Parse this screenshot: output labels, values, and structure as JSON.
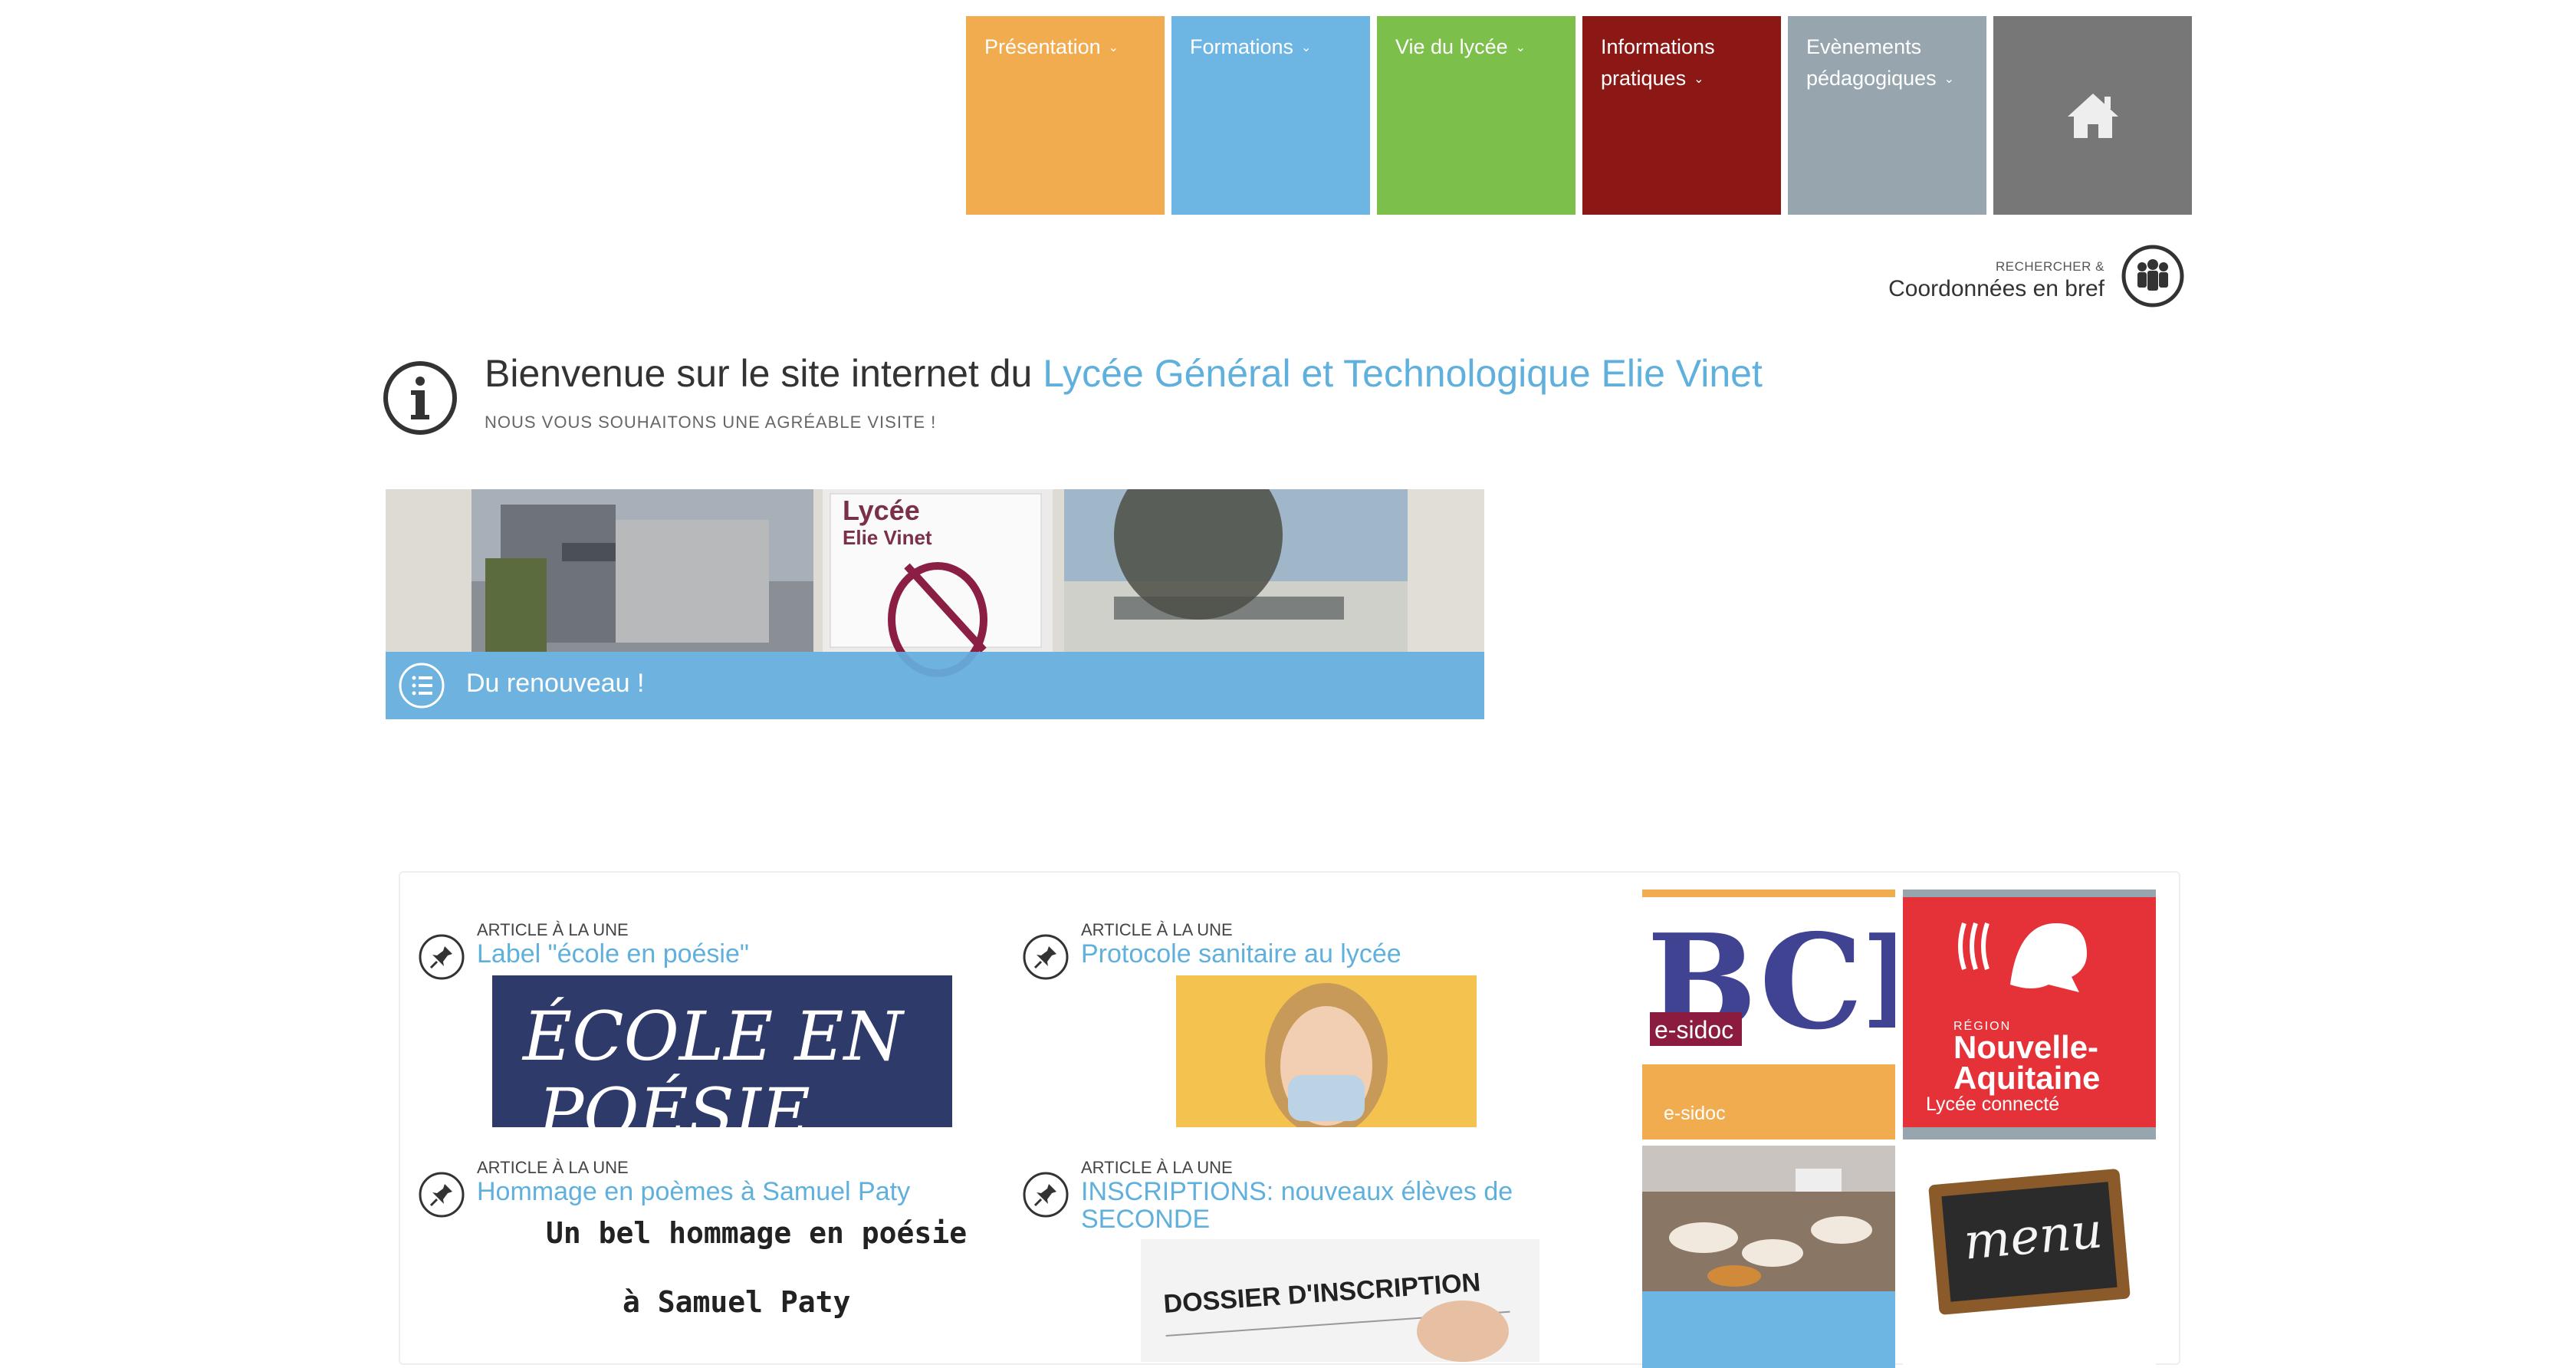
{
  "nav": {
    "items": [
      {
        "label": "Présentation",
        "color": "#f1ac4f"
      },
      {
        "label": "Formations",
        "color": "#6db6e3"
      },
      {
        "label": "Vie du lycée",
        "color": "#7cbf4b"
      },
      {
        "label_line1": "Informations",
        "label_line2": "pratiques",
        "color": "#8c1816"
      },
      {
        "label_line1": "Evènements",
        "label_line2": "pédagogiques",
        "color": "#97a6ae"
      }
    ],
    "home_icon": "home-icon",
    "caret": "⌄"
  },
  "contact": {
    "small": "RECHERCHER &",
    "big": "Coordonnées en bref",
    "icon": "people-icon"
  },
  "welcome": {
    "prefix": "Bienvenue sur le site internet du ",
    "highlight": "Lycée Général et Technologique Elie Vinet",
    "subtitle": "NOUS VOUS SOUHAITONS UNE AGRÉABLE VISITE !"
  },
  "banner": {
    "caption": "Du renouveau !",
    "sign_line1": "Lycée",
    "sign_line2": "Elie Vinet"
  },
  "articles": [
    {
      "kicker": "ARTICLE À LA UNE",
      "title": "Label \"école en poésie\"",
      "image_text_1": "ÉCOLE EN",
      "image_text_2": "POÉSIE"
    },
    {
      "kicker": "ARTICLE À LA UNE",
      "title": "Protocole sanitaire au lycée"
    },
    {
      "kicker": "ARTICLE À LA UNE",
      "title": "Hommage en poèmes à Samuel Paty",
      "body_line1": "Un bel hommage en poésie",
      "body_line2": "à Samuel Paty"
    },
    {
      "kicker": "ARTICLE À LA UNE",
      "title_line1": "INSCRIPTIONS: nouveaux élèves de",
      "title_line2": "SECONDE",
      "image_text": "DOSSIER D'INSCRIPTION"
    }
  ],
  "shortcuts": [
    {
      "label": "e-sidoc",
      "logo_text": "BCDI",
      "logo_sub": "e-sidoc"
    },
    {
      "label": "Lycée connecté",
      "logo_small": "RÉGION",
      "logo_line1": "Nouvelle-",
      "logo_line2": "Aquitaine"
    },
    {
      "label": ""
    },
    {
      "label": "",
      "board_text": "menu"
    }
  ],
  "colors": {
    "accent": "#5fb0dc",
    "orange": "#f1ac4f",
    "red": "#e53238"
  }
}
